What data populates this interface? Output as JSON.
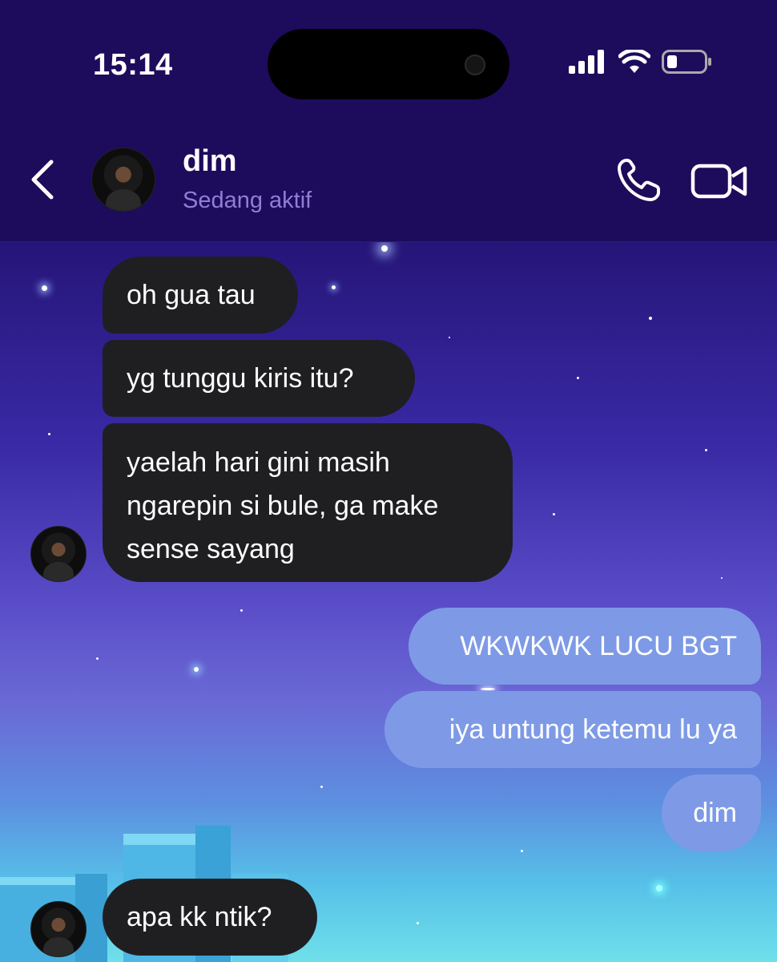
{
  "status_bar": {
    "time": "15:14"
  },
  "header": {
    "contact_name": "dim",
    "contact_status": "Sedang aktif"
  },
  "messages": [
    {
      "direction": "incoming",
      "text": "oh gua tau"
    },
    {
      "direction": "incoming",
      "text": "yg tunggu kiris itu?"
    },
    {
      "direction": "incoming",
      "text": "yaelah hari gini masih ngarepin si bule, ga make sense sayang"
    },
    {
      "direction": "outgoing",
      "text": "WKWKWK LUCU BGT"
    },
    {
      "direction": "outgoing",
      "text": "iya untung ketemu lu ya"
    },
    {
      "direction": "outgoing",
      "text": "dim"
    },
    {
      "direction": "incoming",
      "text": "apa kk ntik?"
    }
  ],
  "colors": {
    "header_bg": "#1d0b5c",
    "incoming_bubble": "#1f1f22",
    "outgoing_bubble": "#7e9ae6",
    "status_text": "#8f7fd4"
  },
  "icons": [
    "back-chevron-icon",
    "phone-icon",
    "video-camera-icon",
    "signal-icon",
    "wifi-icon",
    "battery-icon"
  ]
}
